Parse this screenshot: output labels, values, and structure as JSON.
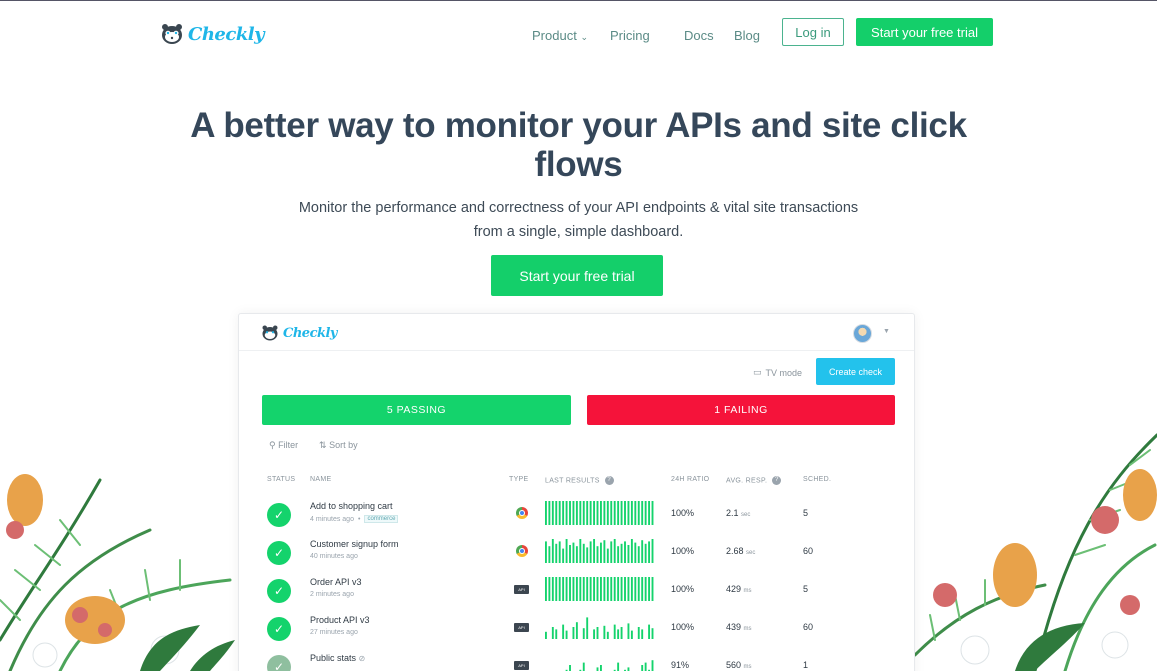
{
  "nav": {
    "logo_text": "Checkly",
    "links": [
      {
        "label": "Product"
      },
      {
        "label": "Pricing"
      },
      {
        "label": "Docs"
      },
      {
        "label": "Blog"
      }
    ],
    "login_label": "Log in",
    "trial_label": "Start your free trial"
  },
  "hero": {
    "title": "A better way to monitor your APIs and site click flows",
    "subtitle_line1": "Monitor the performance and correctness of your API endpoints & vital site transactions",
    "subtitle_line2": "from a single, simple dashboard.",
    "cta_label": "Start your free trial"
  },
  "dashboard": {
    "logo_text": "Checkly",
    "tv_mode_label": "TV mode",
    "create_check_label": "Create check",
    "passing_label": "5 PASSING",
    "failing_label": "1 FAILING",
    "filter_label": "Filter",
    "sort_label": "Sort by",
    "columns": {
      "status": "STATUS",
      "name": "NAME",
      "type": "TYPE",
      "last_results": "LAST RESULTS",
      "ratio": "24H RATIO",
      "avg_resp": "AVG. RESP.",
      "sched": "SCHED."
    },
    "rows": [
      {
        "name": "Add to shopping cart",
        "meta": "4 minutes ago",
        "tag": "commerce",
        "type": "browser",
        "ratio": "100%",
        "resp_value": "2.1",
        "resp_unit": "sec",
        "sched": "5",
        "bar_levels": [
          1,
          1,
          1,
          1,
          1,
          1,
          1,
          1,
          1,
          1,
          1,
          1,
          1,
          1,
          1,
          1,
          1,
          1,
          1,
          1,
          1,
          1,
          1,
          1,
          1,
          1,
          1,
          1,
          1,
          1,
          1,
          1
        ]
      },
      {
        "name": "Customer signup form",
        "meta": "40 minutes ago",
        "tag": "",
        "type": "browser",
        "ratio": "100%",
        "resp_value": "2.68",
        "resp_unit": "sec",
        "sched": "60",
        "bar_levels": [
          0.9,
          0.7,
          1,
          0.8,
          0.9,
          0.6,
          1,
          0.75,
          0.85,
          0.7,
          1,
          0.8,
          0.65,
          0.9,
          1,
          0.7,
          0.85,
          0.95,
          0.6,
          0.9,
          1,
          0.7,
          0.8,
          0.9,
          0.75,
          1,
          0.85,
          0.7,
          0.95,
          0.8,
          0.9,
          1
        ]
      },
      {
        "name": "Order API v3",
        "meta": "2 minutes ago",
        "tag": "",
        "type": "api",
        "ratio": "100%",
        "resp_value": "429",
        "resp_unit": "ms",
        "sched": "5",
        "bar_levels": [
          1,
          1,
          1,
          1,
          1,
          1,
          1,
          1,
          1,
          1,
          1,
          1,
          1,
          1,
          1,
          1,
          1,
          1,
          1,
          1,
          1,
          1,
          1,
          1,
          1,
          1,
          1,
          1,
          1,
          1,
          1,
          1
        ]
      },
      {
        "name": "Product API v3",
        "meta": "27 minutes ago",
        "tag": "",
        "type": "api",
        "ratio": "100%",
        "resp_value": "439",
        "resp_unit": "ms",
        "sched": "60",
        "bar_levels": [
          0.3,
          0,
          0.5,
          0.4,
          0,
          0.6,
          0.35,
          0,
          0.5,
          0.7,
          0,
          0.45,
          0.9,
          0,
          0.4,
          0.5,
          0,
          0.55,
          0.3,
          0,
          0.6,
          0.4,
          0.5,
          0,
          0.65,
          0.35,
          0,
          0.5,
          0.4,
          0,
          0.6,
          0.45
        ]
      },
      {
        "name": "Public stats",
        "meta": "",
        "tag": "",
        "type": "api",
        "ratio": "91%",
        "resp_value": "560",
        "resp_unit": "ms",
        "sched": "1",
        "bar_levels": [
          0,
          0,
          0,
          0,
          0,
          0.2,
          0.3,
          0.5,
          0,
          0,
          0.3,
          0.6,
          0,
          0,
          0,
          0.4,
          0.5,
          0,
          0.2,
          0,
          0.3,
          0.6,
          0,
          0.3,
          0.4,
          0,
          0.2,
          0,
          0.5,
          0.6,
          0.3,
          0.7
        ]
      }
    ]
  },
  "colors": {
    "accent_green": "#14cf6a",
    "fail_red": "#f5133a",
    "brand_blue": "#1fb6e8",
    "create_blue": "#23c2ec"
  }
}
